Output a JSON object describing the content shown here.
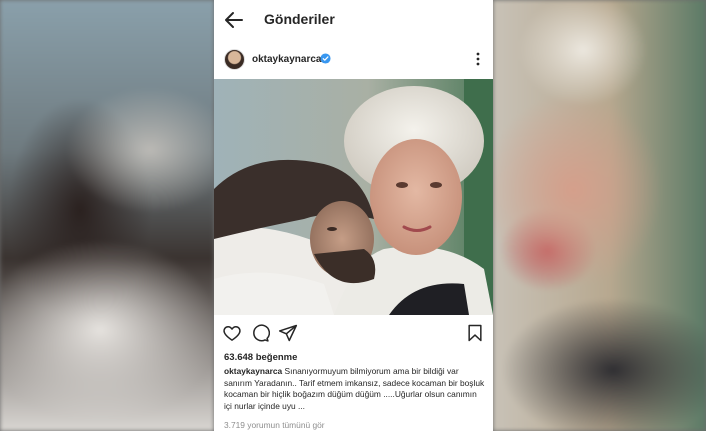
{
  "header": {
    "title": "Gönderiler",
    "back_icon": "arrow-left-icon"
  },
  "post": {
    "username": "oktaykaynarca",
    "verified_icon": "verified-badge-icon",
    "more_icon": "more-vertical-icon",
    "likes": "63.648 beğenme",
    "caption_user": "oktaykaynarca",
    "caption_text": " Sınanıyormuyum bilmiyorum ama bir bildiği var sanırım Yaradanın.. Tarif etmem imkansız, sadece kocaman bir boşluk kocaman bir hiçlik boğazım düğüm düğüm .....Uğurlar olsun canımın içi nurlar içinde uyu ...",
    "comments_link": "3.719 yorumun tümünü gör"
  },
  "actions": {
    "like_icon": "heart-icon",
    "comment_icon": "comment-icon",
    "share_icon": "send-icon",
    "save_icon": "bookmark-icon"
  },
  "colors": {
    "verified": "#3897f0",
    "text": "#262626",
    "muted": "#8e8e8e"
  }
}
